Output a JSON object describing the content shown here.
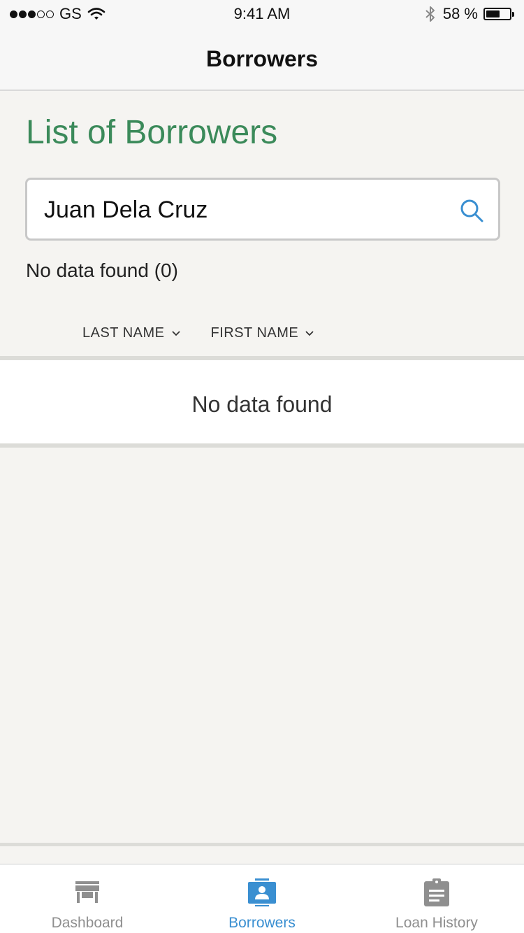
{
  "status_bar": {
    "carrier": "GS",
    "time": "9:41 AM",
    "battery_percent": "58 %",
    "battery_level": 0.58,
    "signal_bars": 3,
    "signal_total": 5
  },
  "nav": {
    "title": "Borrowers"
  },
  "page": {
    "heading": "List of Borrowers",
    "search": {
      "value": "Juan Dela Cruz",
      "placeholder": ""
    },
    "result_count": "No data found (0)",
    "columns": [
      {
        "label": "LAST NAME",
        "icon": "chevron-down-icon"
      },
      {
        "label": "FIRST NAME",
        "icon": "chevron-down-icon"
      }
    ],
    "empty_message": "No data found"
  },
  "tabs": [
    {
      "label": "Dashboard",
      "icon": "store-icon",
      "active": false
    },
    {
      "label": "Borrowers",
      "icon": "contact-book-icon",
      "active": true
    },
    {
      "label": "Loan History",
      "icon": "clipboard-icon",
      "active": false
    }
  ],
  "colors": {
    "heading_green": "#3b8a5a",
    "accent_blue": "#3a8fd1",
    "inactive_gray": "#8f8f8f"
  }
}
